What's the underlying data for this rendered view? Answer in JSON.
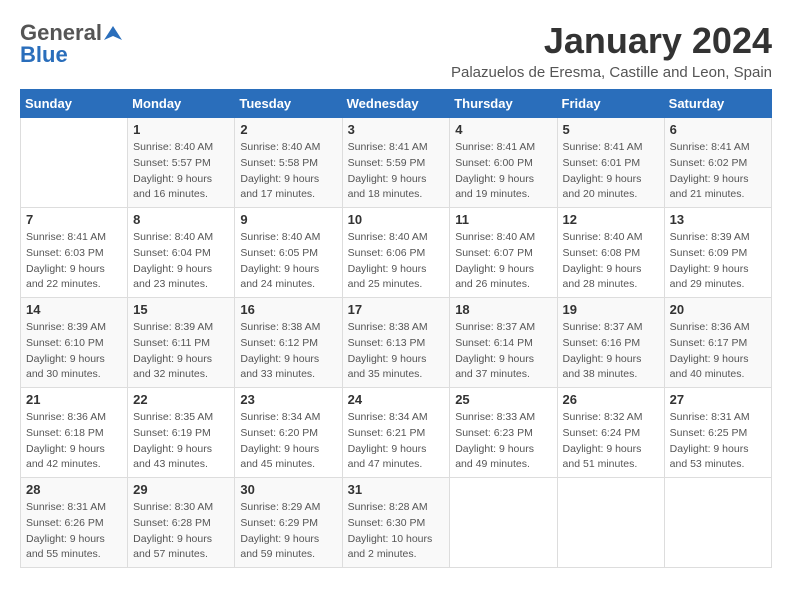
{
  "header": {
    "logo_general": "General",
    "logo_blue": "Blue",
    "month_title": "January 2024",
    "location": "Palazuelos de Eresma, Castille and Leon, Spain"
  },
  "weekdays": [
    "Sunday",
    "Monday",
    "Tuesday",
    "Wednesday",
    "Thursday",
    "Friday",
    "Saturday"
  ],
  "weeks": [
    [
      {
        "day": "",
        "info": []
      },
      {
        "day": "1",
        "info": [
          "Sunrise: 8:40 AM",
          "Sunset: 5:57 PM",
          "Daylight: 9 hours",
          "and 16 minutes."
        ]
      },
      {
        "day": "2",
        "info": [
          "Sunrise: 8:40 AM",
          "Sunset: 5:58 PM",
          "Daylight: 9 hours",
          "and 17 minutes."
        ]
      },
      {
        "day": "3",
        "info": [
          "Sunrise: 8:41 AM",
          "Sunset: 5:59 PM",
          "Daylight: 9 hours",
          "and 18 minutes."
        ]
      },
      {
        "day": "4",
        "info": [
          "Sunrise: 8:41 AM",
          "Sunset: 6:00 PM",
          "Daylight: 9 hours",
          "and 19 minutes."
        ]
      },
      {
        "day": "5",
        "info": [
          "Sunrise: 8:41 AM",
          "Sunset: 6:01 PM",
          "Daylight: 9 hours",
          "and 20 minutes."
        ]
      },
      {
        "day": "6",
        "info": [
          "Sunrise: 8:41 AM",
          "Sunset: 6:02 PM",
          "Daylight: 9 hours",
          "and 21 minutes."
        ]
      }
    ],
    [
      {
        "day": "7",
        "info": [
          "Sunrise: 8:41 AM",
          "Sunset: 6:03 PM",
          "Daylight: 9 hours",
          "and 22 minutes."
        ]
      },
      {
        "day": "8",
        "info": [
          "Sunrise: 8:40 AM",
          "Sunset: 6:04 PM",
          "Daylight: 9 hours",
          "and 23 minutes."
        ]
      },
      {
        "day": "9",
        "info": [
          "Sunrise: 8:40 AM",
          "Sunset: 6:05 PM",
          "Daylight: 9 hours",
          "and 24 minutes."
        ]
      },
      {
        "day": "10",
        "info": [
          "Sunrise: 8:40 AM",
          "Sunset: 6:06 PM",
          "Daylight: 9 hours",
          "and 25 minutes."
        ]
      },
      {
        "day": "11",
        "info": [
          "Sunrise: 8:40 AM",
          "Sunset: 6:07 PM",
          "Daylight: 9 hours",
          "and 26 minutes."
        ]
      },
      {
        "day": "12",
        "info": [
          "Sunrise: 8:40 AM",
          "Sunset: 6:08 PM",
          "Daylight: 9 hours",
          "and 28 minutes."
        ]
      },
      {
        "day": "13",
        "info": [
          "Sunrise: 8:39 AM",
          "Sunset: 6:09 PM",
          "Daylight: 9 hours",
          "and 29 minutes."
        ]
      }
    ],
    [
      {
        "day": "14",
        "info": [
          "Sunrise: 8:39 AM",
          "Sunset: 6:10 PM",
          "Daylight: 9 hours",
          "and 30 minutes."
        ]
      },
      {
        "day": "15",
        "info": [
          "Sunrise: 8:39 AM",
          "Sunset: 6:11 PM",
          "Daylight: 9 hours",
          "and 32 minutes."
        ]
      },
      {
        "day": "16",
        "info": [
          "Sunrise: 8:38 AM",
          "Sunset: 6:12 PM",
          "Daylight: 9 hours",
          "and 33 minutes."
        ]
      },
      {
        "day": "17",
        "info": [
          "Sunrise: 8:38 AM",
          "Sunset: 6:13 PM",
          "Daylight: 9 hours",
          "and 35 minutes."
        ]
      },
      {
        "day": "18",
        "info": [
          "Sunrise: 8:37 AM",
          "Sunset: 6:14 PM",
          "Daylight: 9 hours",
          "and 37 minutes."
        ]
      },
      {
        "day": "19",
        "info": [
          "Sunrise: 8:37 AM",
          "Sunset: 6:16 PM",
          "Daylight: 9 hours",
          "and 38 minutes."
        ]
      },
      {
        "day": "20",
        "info": [
          "Sunrise: 8:36 AM",
          "Sunset: 6:17 PM",
          "Daylight: 9 hours",
          "and 40 minutes."
        ]
      }
    ],
    [
      {
        "day": "21",
        "info": [
          "Sunrise: 8:36 AM",
          "Sunset: 6:18 PM",
          "Daylight: 9 hours",
          "and 42 minutes."
        ]
      },
      {
        "day": "22",
        "info": [
          "Sunrise: 8:35 AM",
          "Sunset: 6:19 PM",
          "Daylight: 9 hours",
          "and 43 minutes."
        ]
      },
      {
        "day": "23",
        "info": [
          "Sunrise: 8:34 AM",
          "Sunset: 6:20 PM",
          "Daylight: 9 hours",
          "and 45 minutes."
        ]
      },
      {
        "day": "24",
        "info": [
          "Sunrise: 8:34 AM",
          "Sunset: 6:21 PM",
          "Daylight: 9 hours",
          "and 47 minutes."
        ]
      },
      {
        "day": "25",
        "info": [
          "Sunrise: 8:33 AM",
          "Sunset: 6:23 PM",
          "Daylight: 9 hours",
          "and 49 minutes."
        ]
      },
      {
        "day": "26",
        "info": [
          "Sunrise: 8:32 AM",
          "Sunset: 6:24 PM",
          "Daylight: 9 hours",
          "and 51 minutes."
        ]
      },
      {
        "day": "27",
        "info": [
          "Sunrise: 8:31 AM",
          "Sunset: 6:25 PM",
          "Daylight: 9 hours",
          "and 53 minutes."
        ]
      }
    ],
    [
      {
        "day": "28",
        "info": [
          "Sunrise: 8:31 AM",
          "Sunset: 6:26 PM",
          "Daylight: 9 hours",
          "and 55 minutes."
        ]
      },
      {
        "day": "29",
        "info": [
          "Sunrise: 8:30 AM",
          "Sunset: 6:28 PM",
          "Daylight: 9 hours",
          "and 57 minutes."
        ]
      },
      {
        "day": "30",
        "info": [
          "Sunrise: 8:29 AM",
          "Sunset: 6:29 PM",
          "Daylight: 9 hours",
          "and 59 minutes."
        ]
      },
      {
        "day": "31",
        "info": [
          "Sunrise: 8:28 AM",
          "Sunset: 6:30 PM",
          "Daylight: 10 hours",
          "and 2 minutes."
        ]
      },
      {
        "day": "",
        "info": []
      },
      {
        "day": "",
        "info": []
      },
      {
        "day": "",
        "info": []
      }
    ]
  ]
}
